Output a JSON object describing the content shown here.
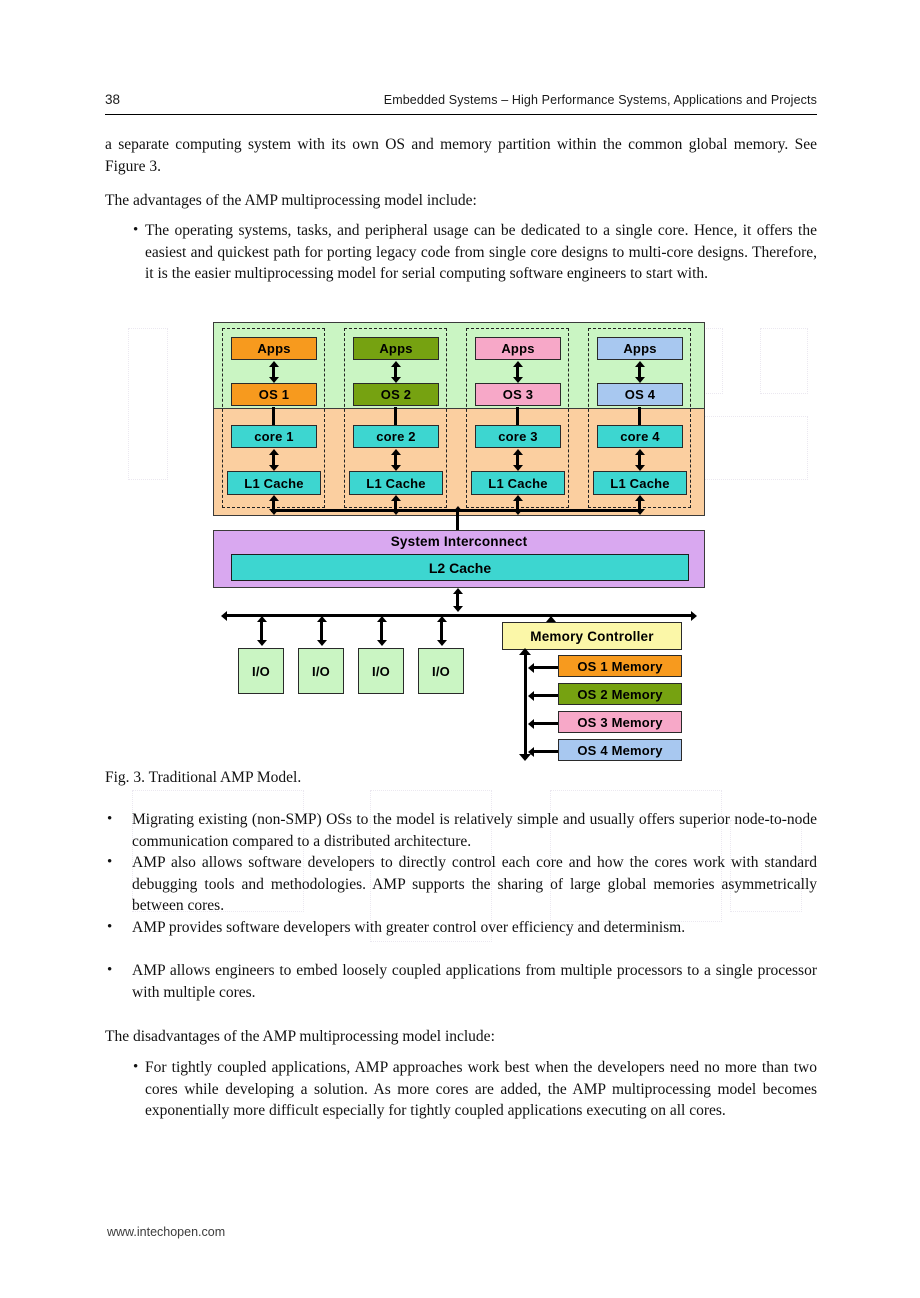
{
  "header": {
    "page_number": "38",
    "running_title": "Embedded Systems – High Performance Systems, Applications and Projects"
  },
  "body": {
    "intro_paragraph": "a separate computing system with its own OS and memory partition within the common global memory. See Figure 3.",
    "advantages_lead": "The advantages of the AMP multiprocessing model include:",
    "advantage_bullet_1": "The operating systems, tasks, and peripheral usage can be dedicated to a single core. Hence, it offers the easiest and quickest path for porting legacy code from single core designs to multi-core designs. Therefore, it is the easier multiprocessing model for serial computing software engineers to start with.",
    "bullet_marker": "•",
    "figure_caption": "Fig. 3. Traditional AMP Model.",
    "advantage_bullet_2": "Migrating existing (non-SMP) OSs to the model is relatively simple and usually offers superior node-to-node communication compared to a distributed architecture.",
    "advantage_bullet_3": "AMP also allows software developers to directly control each core and how the cores work with standard debugging tools and methodologies. AMP supports the sharing of large global memories asymmetrically between cores.",
    "advantage_bullet_4": "AMP provides software developers with greater control over efficiency and determinism.",
    "advantage_bullet_5": "AMP allows engineers to embed loosely coupled applications from multiple processors to a single processor with multiple cores.",
    "disadvantages_lead": "The disadvantages of the AMP multiprocessing model include:",
    "disadvantage_bullet_1": "For tightly coupled applications, AMP approaches work best when the developers need no more than two cores while developing a solution. As more cores are added, the AMP multiprocessing model becomes exponentially more difficult especially for tightly coupled applications executing on all cores."
  },
  "footer": {
    "url": "www.intechopen.com"
  },
  "figure": {
    "columns": [
      {
        "apps": "Apps",
        "os": "OS 1",
        "core": "core 1",
        "l1": "L1 Cache",
        "color": "#f79a1e"
      },
      {
        "apps": "Apps",
        "os": "OS 2",
        "core": "core 2",
        "l1": "L1 Cache",
        "color": "#76a211"
      },
      {
        "apps": "Apps",
        "os": "OS 3",
        "core": "core 3",
        "l1": "L1 Cache",
        "color": "#f7a8c8"
      },
      {
        "apps": "Apps",
        "os": "OS 4",
        "core": "core 4",
        "l1": "L1 Cache",
        "color": "#a8c8f0"
      }
    ],
    "interconnect_label": "System Interconnect",
    "l2_cache_label": "L2 Cache",
    "io_blocks": [
      "I/O",
      "I/O",
      "I/O",
      "I/O"
    ],
    "memory_controller_label": "Memory Controller",
    "memories": [
      {
        "label": "OS 1 Memory",
        "color": "#f79a1e"
      },
      {
        "label": "OS 2 Memory",
        "color": "#76a211"
      },
      {
        "label": "OS 3 Memory",
        "color": "#f7a8c8"
      },
      {
        "label": "OS 4 Memory",
        "color": "#a8c8f0"
      }
    ],
    "colors": {
      "band_top": "#caf5c3",
      "band_bottom": "#fbcfa0",
      "core_teal": "#3dd6d0",
      "interconnect_purple": "#d9a8f0",
      "io_green": "#caf5c3",
      "memory_controller_yellow": "#fbf7a8"
    }
  }
}
